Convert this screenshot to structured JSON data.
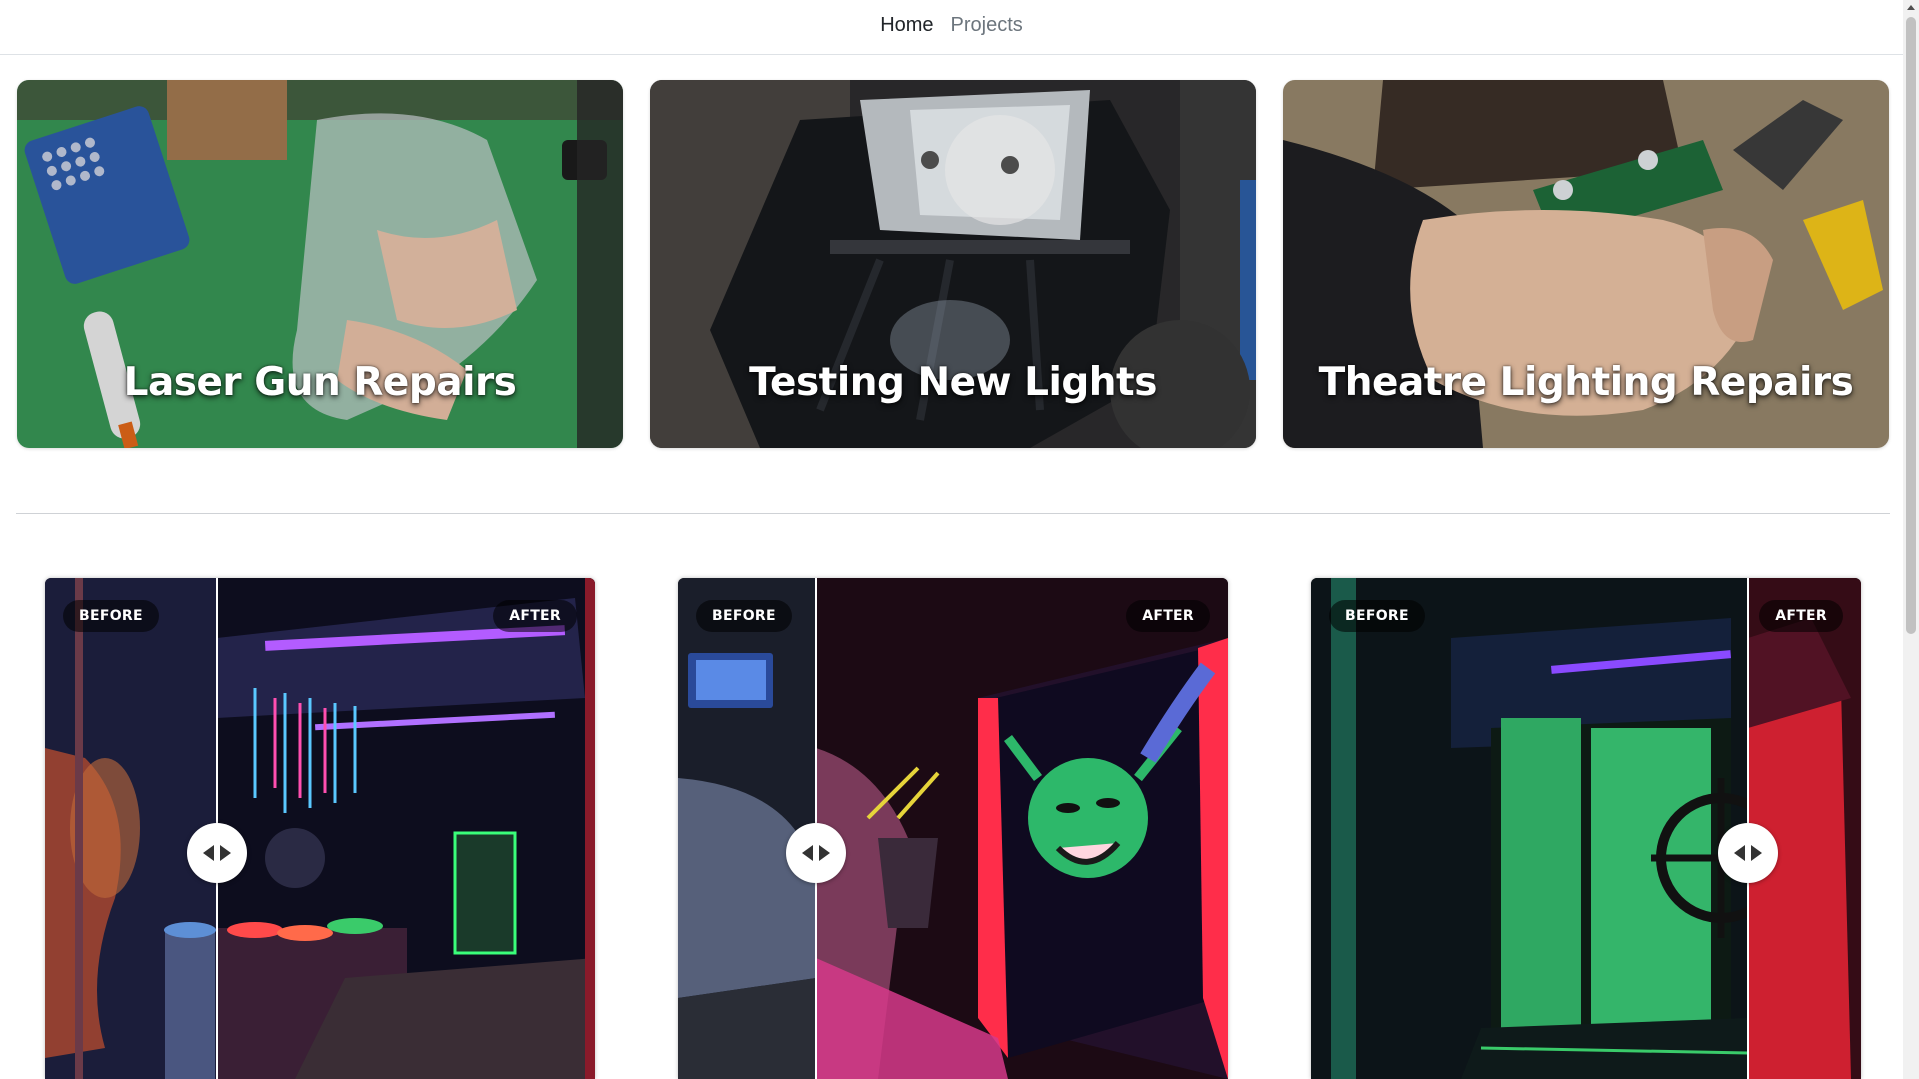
{
  "nav": {
    "items": [
      {
        "label": "Home",
        "active": true
      },
      {
        "label": "Projects",
        "active": false
      }
    ]
  },
  "project_cards": [
    {
      "title": "Laser Gun Repairs"
    },
    {
      "title": "Testing New Lights"
    },
    {
      "title": "Theatre Lighting Repairs"
    }
  ],
  "comparisons": [
    {
      "before_label": "BEFORE",
      "after_label": "AFTER",
      "slider_percent": 31
    },
    {
      "before_label": "BEFORE",
      "after_label": "AFTER",
      "slider_percent": 25
    },
    {
      "before_label": "BEFORE",
      "after_label": "AFTER",
      "slider_percent": 79
    }
  ],
  "colors": {
    "nav_active": "#212529",
    "nav_inactive": "#6c757d",
    "card_title": "#ffffff"
  },
  "icons": {
    "slider_handle": "left-right-arrows-icon",
    "scrollbar": "scroll-up-arrow-icon"
  }
}
